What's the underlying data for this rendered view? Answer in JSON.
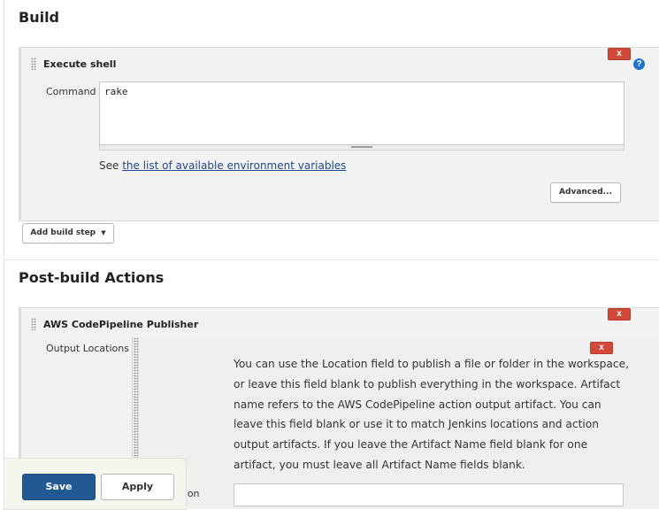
{
  "build": {
    "title": "Build",
    "step": {
      "title": "Execute shell",
      "command_label": "Command",
      "command_value": "rake",
      "see_prefix": "See ",
      "env_link": "the list of available environment variables",
      "advanced_label": "Advanced...",
      "close_label": "x",
      "help_label": "?"
    },
    "add_step_label": "Add build step"
  },
  "post_build": {
    "title": "Post-build Actions",
    "publisher": {
      "title": "AWS CodePipeline Publisher",
      "close_label": "x",
      "output_locations_label": "Output Locations",
      "inner_close_label": "x",
      "info_text": "You can use the Location field to publish a file or folder in the workspace, or leave this field blank to publish everything in the workspace. Artifact name refers to the AWS CodePipeline action output artifact. You can leave this field blank or use it to match Jenkins locations and action output artifacts. If you leave the Artifact Name field blank for one artifact, you must leave all Artifact Name fields blank.",
      "location_label": "Location",
      "location_value": ""
    }
  },
  "bottom_bar": {
    "save_label": "Save",
    "apply_label": "Apply"
  }
}
